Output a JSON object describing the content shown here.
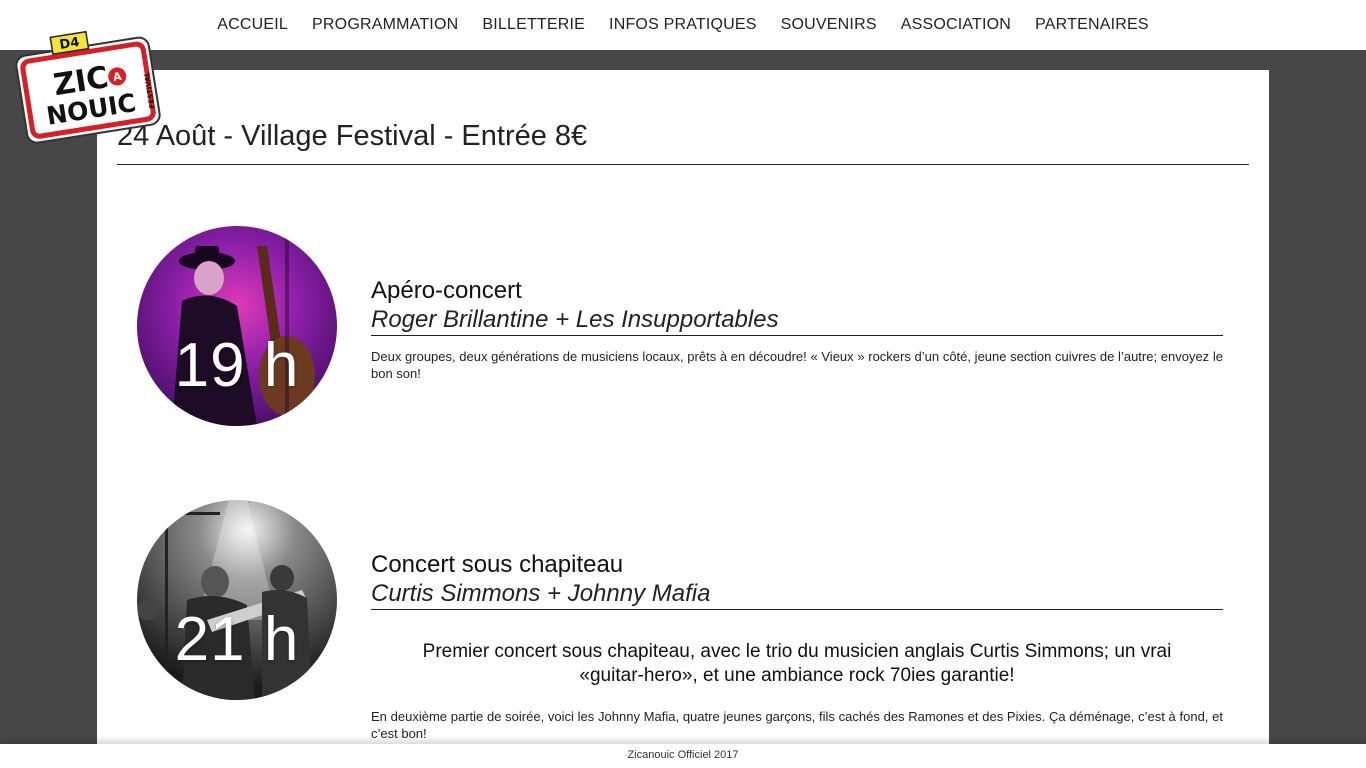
{
  "nav": {
    "items": [
      "ACCUEIL",
      "PROGRAMMATION",
      "BILLETTERIE",
      "INFOS PRATIQUES",
      "SOUVENIRS",
      "ASSOCIATION",
      "PARTENAIRES"
    ]
  },
  "logo": {
    "text_top": "D4",
    "text_main_1": "ZIC",
    "text_a": "A",
    "text_main_2": "NOUIC",
    "text_side": "FESTIVAL"
  },
  "page": {
    "title": "24 Août - Village Festival - Entrée 8€"
  },
  "events": [
    {
      "time": "19 h",
      "heading": "Apéro-concert",
      "artists": "Roger Brillantine + Les Insupportables",
      "description": "Deux groupes, deux générations de musiciens locaux, prêts à en découdre! « Vieux » rockers d’un côté, jeune section cuivres de l’autre; envoyez le bon son!"
    },
    {
      "time": "21 h",
      "heading": "Concert sous chapiteau",
      "artists": "Curtis Simmons + Johnny Mafia",
      "lead": "Premier concert sous chapiteau, avec le trio du musicien anglais Curtis Simmons; un vrai «guitar-hero», et une ambiance rock 70ies garantie!",
      "description": "En deuxième partie de soirée, voici les Johnny Mafia, quatre jeunes garçons, fils cachés des Ramones et des Pixies. Ça déménage, c’est à fond, et c’est bon!"
    }
  ],
  "footer": {
    "text": "Zicanouic Officiel 2017"
  },
  "colors": {
    "background": "#474747",
    "panel": "#ffffff",
    "logo_red": "#d61f26",
    "logo_yellow": "#f2e33a"
  }
}
